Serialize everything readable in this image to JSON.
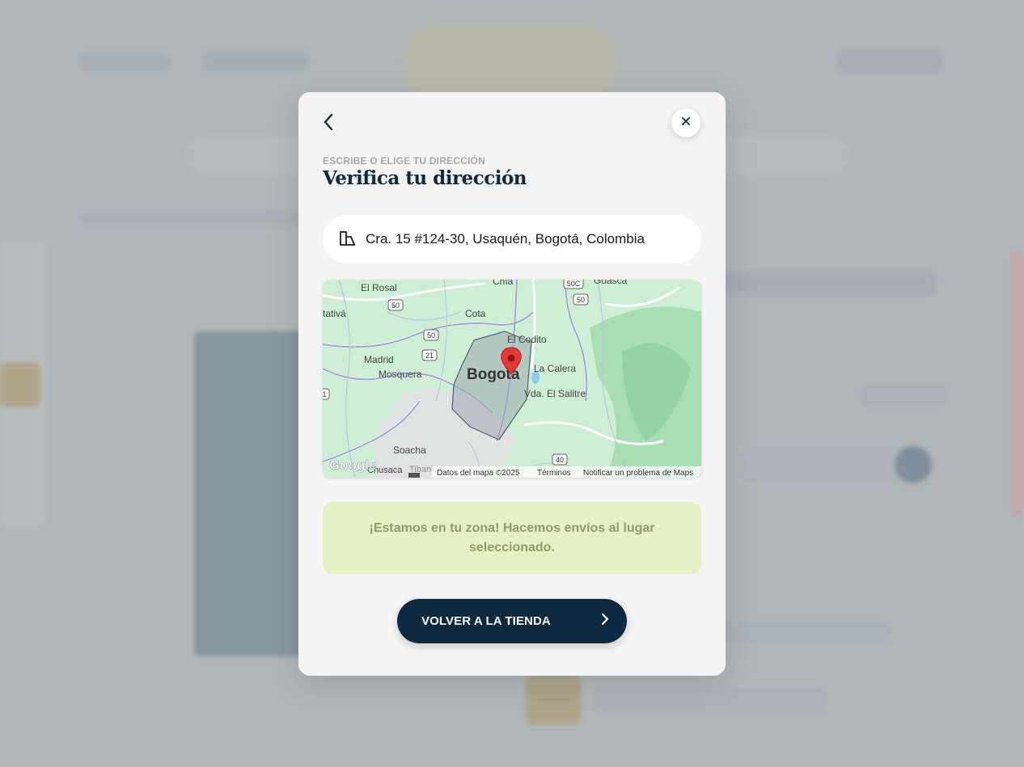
{
  "modal": {
    "eyebrow": "ESCRIBE O ELIGE TU DIRECCIÓN",
    "title": "Verifica tu dirección",
    "address": "Cra. 15 #124-30, Usaquén, Bogotá, Colombia",
    "notice": "¡Estamos en tu zona! Hacemos envíos al lugar seleccionado.",
    "cta_label": "VOLVER A LA TIENDA"
  },
  "map": {
    "city_label": "Bogota",
    "places": {
      "el_rosal": "El Rosal",
      "chia": "Chía",
      "guasca": "Guasca",
      "tativa": "tativá",
      "cota": "Cota",
      "el_codito": "El Codito",
      "madrid": "Madrid",
      "mosquera": "Mosquera",
      "la_calera": "La Calera",
      "el_salitre": "Vda. El Salitre",
      "soacha": "Soacha",
      "chusaca": "Chusaca",
      "tibanica": "Tibanica"
    },
    "road_shields": {
      "r50a": "50",
      "r50b": "50",
      "r50c": "50C",
      "r50d": "50",
      "r21": "21",
      "r40": "40",
      "r1": "1"
    },
    "google_logo": "Google",
    "attribution": "Datos del mapa ©2025",
    "terms": "Términos",
    "report": "Notificar un problema de Maps"
  },
  "colors": {
    "primary": "#0f2a3f",
    "notice_bg": "#e5f1c5",
    "notice_text": "#8d9c6b",
    "pin": "#e53935",
    "map_land": "#cdeed4"
  }
}
